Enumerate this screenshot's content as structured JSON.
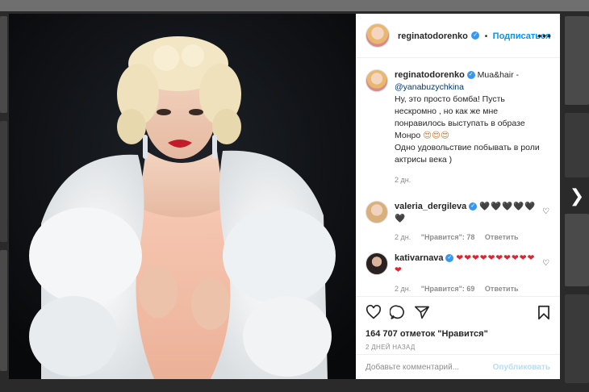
{
  "modal": {
    "author": {
      "username": "reginatodorenko",
      "follow_label": "Подписаться",
      "separator": "•"
    },
    "more_glyph": "•••",
    "caption": {
      "username": "reginatodorenko",
      "line1": "Mua&hair -",
      "mention": "@yanabuzychkina",
      "text_a": "Ну, это просто бомба! Пусть нескромно , но как же мне понравилось выступать в образе Монро ",
      "emojis": "😍😍😍",
      "text_b": "Одно удовольствие побывать в роли актрисы века )",
      "time": "2 дн."
    },
    "comments": [
      {
        "username": "valeria_dergileva",
        "emoji_line": "🖤🖤🖤🖤🖤🖤",
        "time": "2 дн.",
        "likes_label": "\"Нравится\": 78",
        "reply_label": "Ответить"
      },
      {
        "username": "kativarnava",
        "emoji_line": "❤❤❤❤❤❤❤❤❤❤❤",
        "time": "2 дн.",
        "likes_label": "\"Нравится\": 69",
        "reply_label": "Ответить"
      }
    ],
    "likes_text": "164 707 отметок \"Нравится\"",
    "age_text": "2 ДНЕЙ НАЗАД",
    "comment_placeholder": "Добавьте комментарий...",
    "post_label": "Опубликовать",
    "icons": {
      "like": "heart-icon",
      "comment": "comment-icon",
      "share": "share-icon",
      "save": "bookmark-icon",
      "next": "chevron-right-icon"
    }
  }
}
